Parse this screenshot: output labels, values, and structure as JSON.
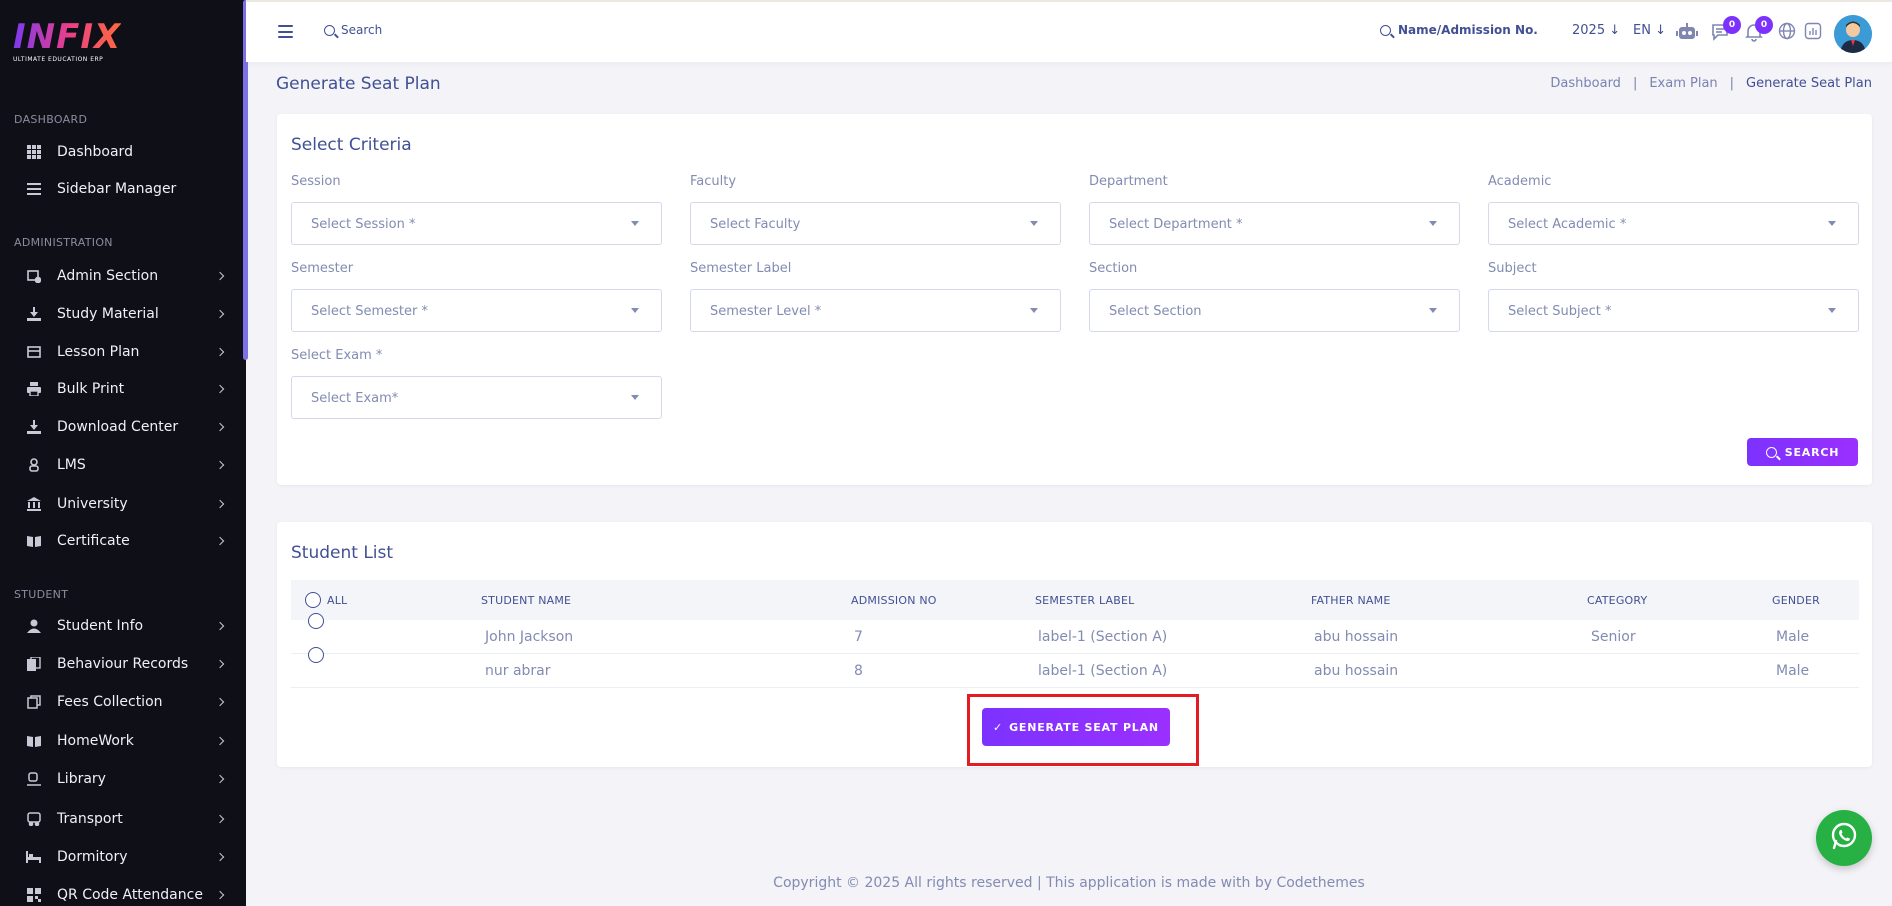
{
  "app": {
    "logo_text": "INFIX",
    "logo_subtitle": "ULTIMATE EDUCATION ERP"
  },
  "sidebar": {
    "sections": [
      {
        "title": "DASHBOARD",
        "items": [
          {
            "label": "Dashboard",
            "icon": "grid-icon",
            "chevron": false
          },
          {
            "label": "Sidebar Manager",
            "icon": "menu-icon",
            "chevron": false
          }
        ]
      },
      {
        "title": "ADMINISTRATION",
        "items": [
          {
            "label": "Admin Section",
            "icon": "admin-icon",
            "chevron": true
          },
          {
            "label": "Study Material",
            "icon": "download-icon",
            "chevron": true
          },
          {
            "label": "Lesson Plan",
            "icon": "book-icon",
            "chevron": true
          },
          {
            "label": "Bulk Print",
            "icon": "printer-icon",
            "chevron": true
          },
          {
            "label": "Download Center",
            "icon": "download-icon",
            "chevron": true
          },
          {
            "label": "LMS",
            "icon": "lms-icon",
            "chevron": true
          },
          {
            "label": "University",
            "icon": "university-icon",
            "chevron": true
          },
          {
            "label": "Certificate",
            "icon": "certificate-icon",
            "chevron": true
          }
        ]
      },
      {
        "title": "STUDENT",
        "items": [
          {
            "label": "Student Info",
            "icon": "user-icon",
            "chevron": true
          },
          {
            "label": "Behaviour Records",
            "icon": "records-icon",
            "chevron": true
          },
          {
            "label": "Fees Collection",
            "icon": "fees-icon",
            "chevron": true
          },
          {
            "label": "HomeWork",
            "icon": "book-icon",
            "chevron": true
          },
          {
            "label": "Library",
            "icon": "library-icon",
            "chevron": true
          },
          {
            "label": "Transport",
            "icon": "bus-icon",
            "chevron": true
          },
          {
            "label": "Dormitory",
            "icon": "bed-icon",
            "chevron": true
          },
          {
            "label": "QR Code Attendance",
            "icon": "qr-icon",
            "chevron": true
          }
        ]
      }
    ]
  },
  "topbar": {
    "search_label": "Search",
    "name_search_label": "Name/Admission No.",
    "year": "2025",
    "language": "EN",
    "messages_count": "0",
    "notifications_count": "0"
  },
  "page": {
    "title": "Generate Seat Plan",
    "breadcrumb": [
      "Dashboard",
      "|",
      "Exam Plan",
      "|",
      "Generate Seat Plan"
    ]
  },
  "criteria": {
    "title": "Select Criteria",
    "fields": [
      {
        "label": "Session",
        "placeholder": "Select Session *"
      },
      {
        "label": "Faculty",
        "placeholder": "Select Faculty"
      },
      {
        "label": "Department",
        "placeholder": "Select Department *"
      },
      {
        "label": "Academic",
        "placeholder": "Select Academic *"
      },
      {
        "label": "Semester",
        "placeholder": "Select Semester *"
      },
      {
        "label": "Semester Label",
        "placeholder": "Semester Level *"
      },
      {
        "label": "Section",
        "placeholder": "Select Section"
      },
      {
        "label": "Subject",
        "placeholder": "Select Subject *"
      },
      {
        "label": "Select Exam *",
        "placeholder": "Select Exam*"
      }
    ],
    "search_button": "SEARCH"
  },
  "students": {
    "title": "Student List",
    "all_label": "ALL",
    "columns": [
      "STUDENT NAME",
      "ADMISSION NO",
      "SEMESTER LABEL",
      "FATHER NAME",
      "CATEGORY",
      "GENDER"
    ],
    "rows": [
      {
        "name": "John Jackson",
        "admission": "7",
        "semester_label": "label-1 (Section A)",
        "father": "abu hossain",
        "category": "Senior",
        "gender": "Male"
      },
      {
        "name": "nur abrar",
        "admission": "8",
        "semester_label": "label-1 (Section A)",
        "father": "abu hossain",
        "category": "",
        "gender": "Male"
      }
    ],
    "generate_button": "GENERATE SEAT PLAN"
  },
  "footer": {
    "text": "Copyright © 2025 All rights reserved | This application is made with by Codethemes"
  },
  "colors": {
    "accent": "#7c32ff",
    "sidebar_bg": "#0e0f17",
    "text": "#415094",
    "muted": "#828bb2",
    "highlight": "#e31b23",
    "whatsapp": "#27b043"
  }
}
